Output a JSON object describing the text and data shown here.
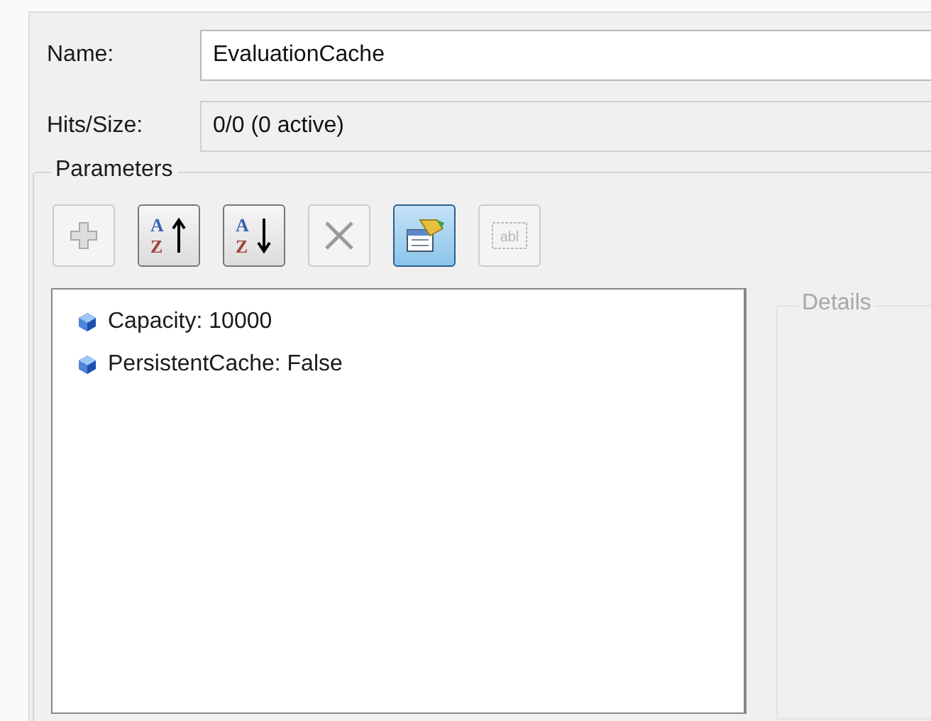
{
  "name_field": {
    "label": "Name:",
    "value": "EvaluationCache"
  },
  "hits_field": {
    "label": "Hits/Size:",
    "value": "0/0 (0 active)"
  },
  "parameters": {
    "title": "Parameters",
    "toolbar": [
      {
        "kind": "add",
        "disabled": true,
        "selected": false
      },
      {
        "kind": "sort-ascending",
        "disabled": false,
        "selected": false,
        "glyphs": [
          "A",
          "Z"
        ]
      },
      {
        "kind": "sort-descending",
        "disabled": false,
        "selected": false,
        "glyphs": [
          "A",
          "Z"
        ]
      },
      {
        "kind": "delete",
        "disabled": true,
        "selected": false
      },
      {
        "kind": "properties",
        "disabled": false,
        "selected": true
      },
      {
        "kind": "text-field",
        "disabled": true,
        "selected": false,
        "glyphs": [
          "abl"
        ]
      }
    ],
    "items": [
      {
        "label": "Capacity: 10000"
      },
      {
        "label": "PersistentCache: False"
      }
    ],
    "details": {
      "title": "Details",
      "disabled": true
    }
  }
}
